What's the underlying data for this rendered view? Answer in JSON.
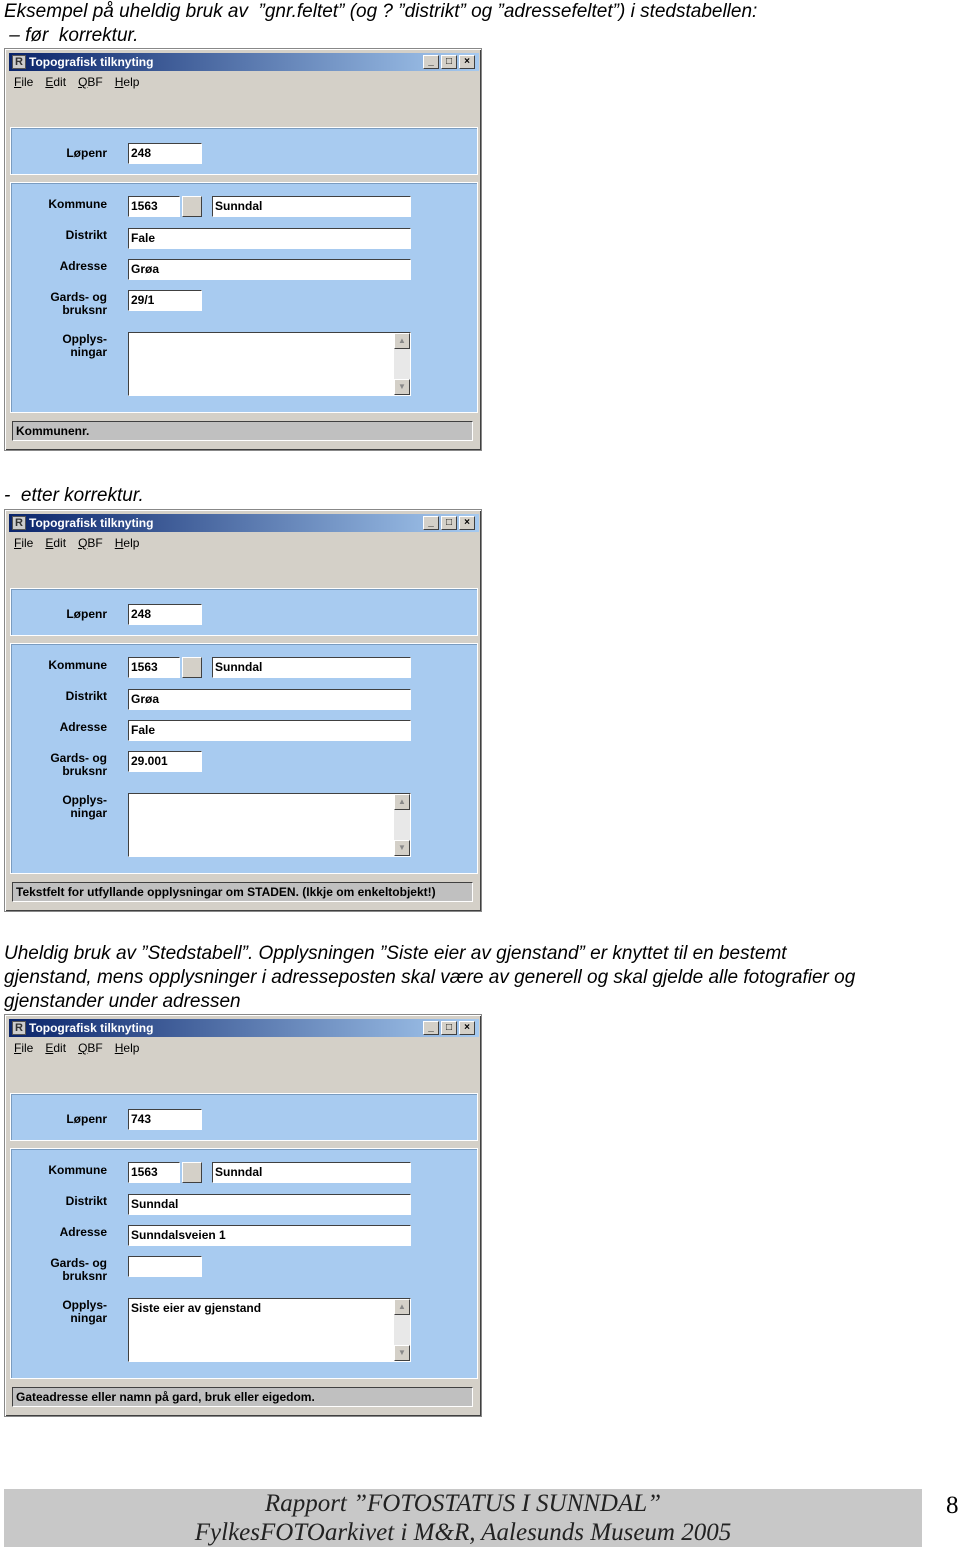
{
  "intro": {
    "line1": "Eksempel på uheldig bruk av  ”gnr.feltet” (og ? ”distrikt” og ”adressefeltet”) i stedstabellen:",
    "line2": " – før  korrektur."
  },
  "middle_caption": "-  etter korrektur.",
  "paragraph": {
    "line1": "Uheldig bruk av ”Stedstabell”. Opplysningen ”Siste eier av gjenstand” er knyttet til en bestemt",
    "line2": "gjenstand, mens opplysninger i adresseposten skal være av generell og skal gjelde alle fotografier og",
    "line3": "gjenstander under adressen"
  },
  "labels": {
    "lopenr": "Løpenr",
    "kommune": "Kommune",
    "distrikt": "Distrikt",
    "adresse": "Adresse",
    "gards": "Gards- og\nbruksnr",
    "opplys": "Opplys-\nningar"
  },
  "window_title": "Topografisk tilknyting",
  "menu": [
    "File",
    "Edit",
    "QBF",
    "Help"
  ],
  "windows": [
    {
      "lopenr": "248",
      "kommune_nr": "1563",
      "kommune_navn": "Sunndal",
      "distrikt": "Fale",
      "adresse": "Grøa",
      "gards": "29/1",
      "opplys": "",
      "status": "Kommunenr."
    },
    {
      "lopenr": "248",
      "kommune_nr": "1563",
      "kommune_navn": "Sunndal",
      "distrikt": "Grøa",
      "adresse": "Fale",
      "gards": "29.001",
      "opplys": "",
      "status": "Tekstfelt for utfyllande opplysningar om STADEN. (Ikkje om enkeltobjekt!)"
    },
    {
      "lopenr": "743",
      "kommune_nr": "1563",
      "kommune_navn": "Sunndal",
      "distrikt": "Sunndal",
      "adresse": "Sunndalsveien 1",
      "gards": "",
      "opplys": "Siste eier av gjenstand",
      "status": "Gateadresse eller namn på gard, bruk eller eigedom."
    }
  ],
  "footer": {
    "line1": "Rapport ”FOTOSTATUS I SUNNDAL”",
    "line2": "FylkesFOTOarkivet i M&R, Aalesunds Museum 2005",
    "page_number": "8"
  }
}
